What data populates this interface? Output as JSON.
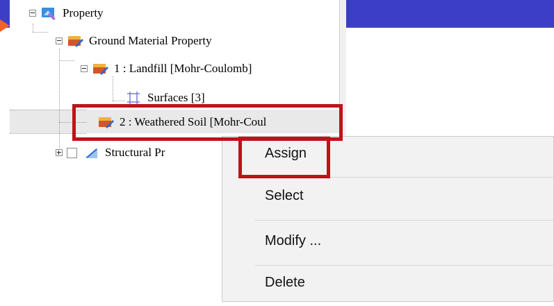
{
  "tree": {
    "items": [
      {
        "label": "Property",
        "icon": "property-icon"
      },
      {
        "label": "Ground Material Property",
        "icon": "ground-material-icon"
      },
      {
        "label": "1 : Landfill [Mohr-Coulomb]",
        "icon": "material-icon"
      },
      {
        "label": "Surfaces [3]",
        "icon": "surface-grid-icon"
      },
      {
        "label": "2 : Weathered Soil [Mohr-Coul",
        "icon": "material-icon"
      },
      {
        "label": "Structural Pr",
        "icon": "structural-icon"
      }
    ]
  },
  "context_menu": {
    "items": [
      {
        "label": "Assign"
      },
      {
        "label": "Select"
      },
      {
        "label": "Modify ..."
      },
      {
        "label": "Delete"
      }
    ]
  },
  "colors": {
    "title_bar": "#3c3ec8",
    "highlight_border": "#c0121a",
    "arrow": "#f0642a"
  }
}
